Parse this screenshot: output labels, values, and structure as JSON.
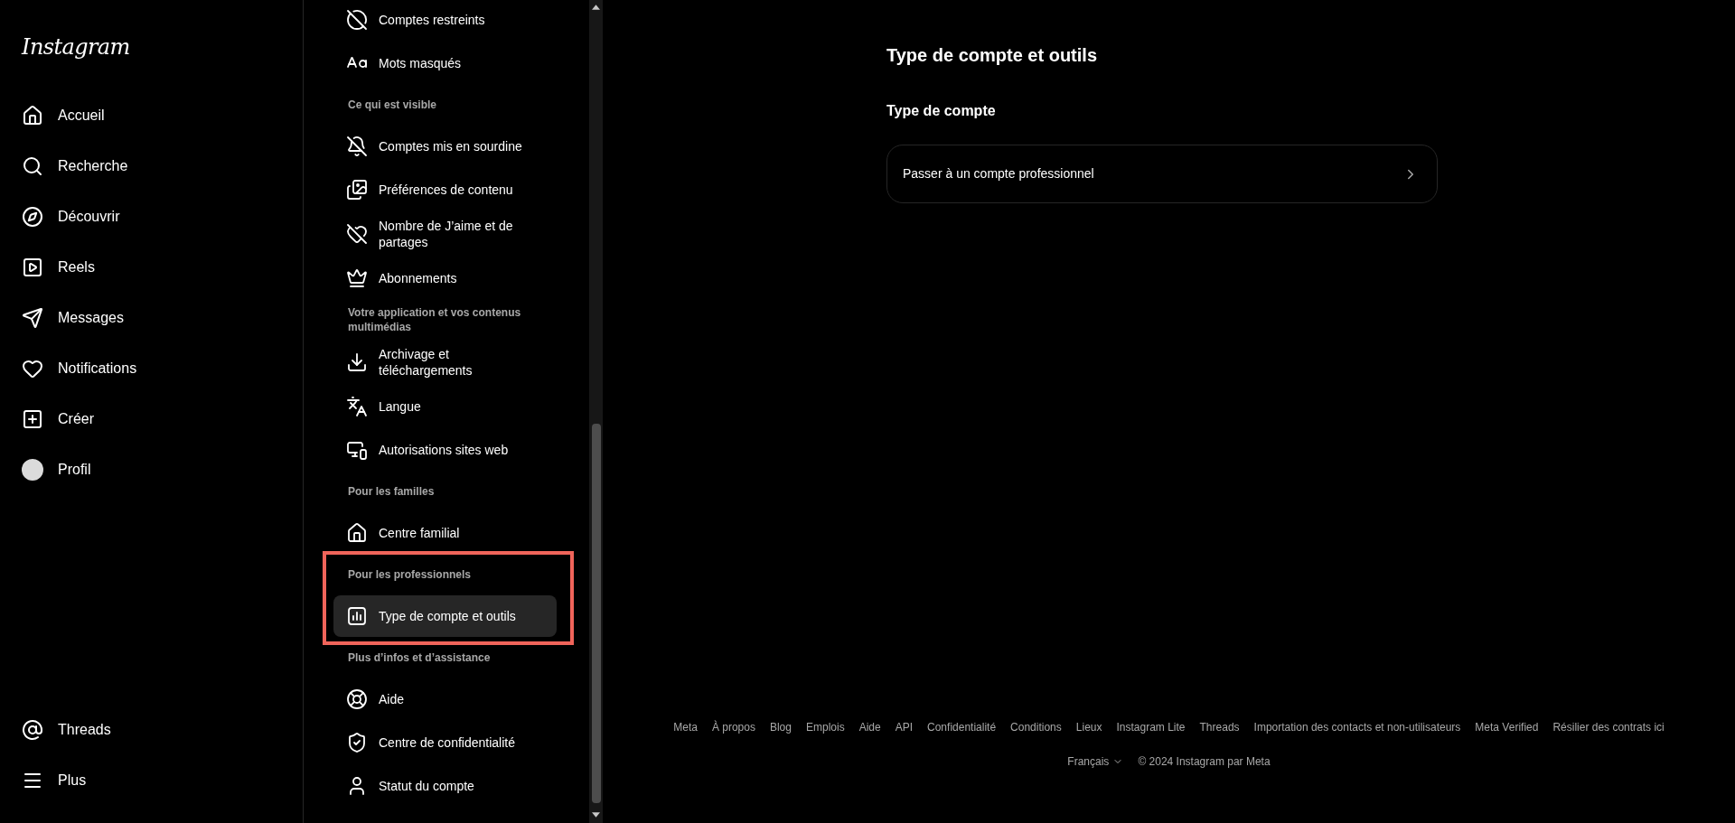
{
  "nav": {
    "logo": "Instagram",
    "items": [
      {
        "label": "Accueil"
      },
      {
        "label": "Recherche"
      },
      {
        "label": "Découvrir"
      },
      {
        "label": "Reels"
      },
      {
        "label": "Messages"
      },
      {
        "label": "Notifications"
      },
      {
        "label": "Créer"
      },
      {
        "label": "Profil"
      }
    ],
    "bottom_items": [
      {
        "label": "Threads"
      },
      {
        "label": "Plus"
      }
    ]
  },
  "settings": [
    {
      "kind": "item",
      "label": "Comptes restreints",
      "selected": false,
      "highlighted": false
    },
    {
      "kind": "item",
      "label": "Mots masqués",
      "selected": false,
      "highlighted": false
    },
    {
      "kind": "header",
      "label": "Ce qui est visible",
      "highlighted": false
    },
    {
      "kind": "item",
      "label": "Comptes mis en sourdine",
      "selected": false,
      "highlighted": false
    },
    {
      "kind": "item",
      "label": "Préférences de contenu",
      "selected": false,
      "highlighted": false
    },
    {
      "kind": "item",
      "label": "Nombre de J’aime et de partages",
      "selected": false,
      "highlighted": false
    },
    {
      "kind": "item",
      "label": "Abonnements",
      "selected": false,
      "highlighted": false
    },
    {
      "kind": "header",
      "label": "Votre application et vos contenus multimédias",
      "highlighted": false
    },
    {
      "kind": "item",
      "label": "Archivage et téléchargements",
      "selected": false,
      "highlighted": false
    },
    {
      "kind": "item",
      "label": "Langue",
      "selected": false,
      "highlighted": false
    },
    {
      "kind": "item",
      "label": "Autorisations sites web",
      "selected": false,
      "highlighted": false
    },
    {
      "kind": "header",
      "label": "Pour les familles",
      "highlighted": false
    },
    {
      "kind": "item",
      "label": "Centre familial",
      "selected": false,
      "highlighted": false
    },
    {
      "kind": "header",
      "label": "Pour les professionnels",
      "highlighted": true
    },
    {
      "kind": "item",
      "label": "Type de compte et outils",
      "selected": true,
      "highlighted": true
    },
    {
      "kind": "header",
      "label": "Plus d’infos et d’assistance",
      "highlighted": false
    },
    {
      "kind": "item",
      "label": "Aide",
      "selected": false,
      "highlighted": false
    },
    {
      "kind": "item",
      "label": "Centre de confidentialité",
      "selected": false,
      "highlighted": false
    },
    {
      "kind": "item",
      "label": "Statut du compte",
      "selected": false,
      "highlighted": false
    }
  ],
  "main": {
    "title": "Type de compte et outils",
    "section": "Type de compte",
    "row": "Passer à un compte professionnel"
  },
  "footer": {
    "links": [
      "Meta",
      "À propos",
      "Blog",
      "Emplois",
      "Aide",
      "API",
      "Confidentialité",
      "Conditions",
      "Lieux",
      "Instagram Lite",
      "Threads",
      "Importation des contacts et non-utilisateurs",
      "Meta Verified",
      "Résilier des contrats ici"
    ],
    "language": "Français",
    "copyright": "© 2024 Instagram par Meta"
  }
}
